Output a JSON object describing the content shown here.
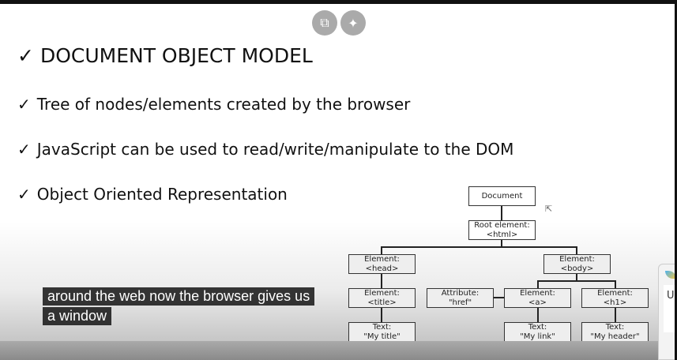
{
  "slide": {
    "title": "DOCUMENT OBJECT MODEL",
    "bullets": [
      "Tree of nodes/elements created by the browser",
      "JavaScript can be used to read/write/manipulate to the DOM",
      "Object Oriented Representation"
    ],
    "check": "✓"
  },
  "diagram": {
    "document": "Document",
    "root": [
      "Root element:",
      "<html>"
    ],
    "head": [
      "Element:",
      "<head>"
    ],
    "body": [
      "Element:",
      "<body>"
    ],
    "title": [
      "Element:",
      "<title>"
    ],
    "attr": [
      "Attribute:",
      "\"href\""
    ],
    "a": [
      "Element:",
      "<a>"
    ],
    "h1": [
      "Element:",
      "<h1>"
    ],
    "text_title": [
      "Text:",
      "\"My title\""
    ],
    "text_link": [
      "Text:",
      "\"My link\""
    ],
    "text_header": [
      "Text:",
      "\"My header\""
    ]
  },
  "captions": [
    "around the web now the browser gives us",
    "a window"
  ],
  "widget": {
    "letter": "U"
  }
}
